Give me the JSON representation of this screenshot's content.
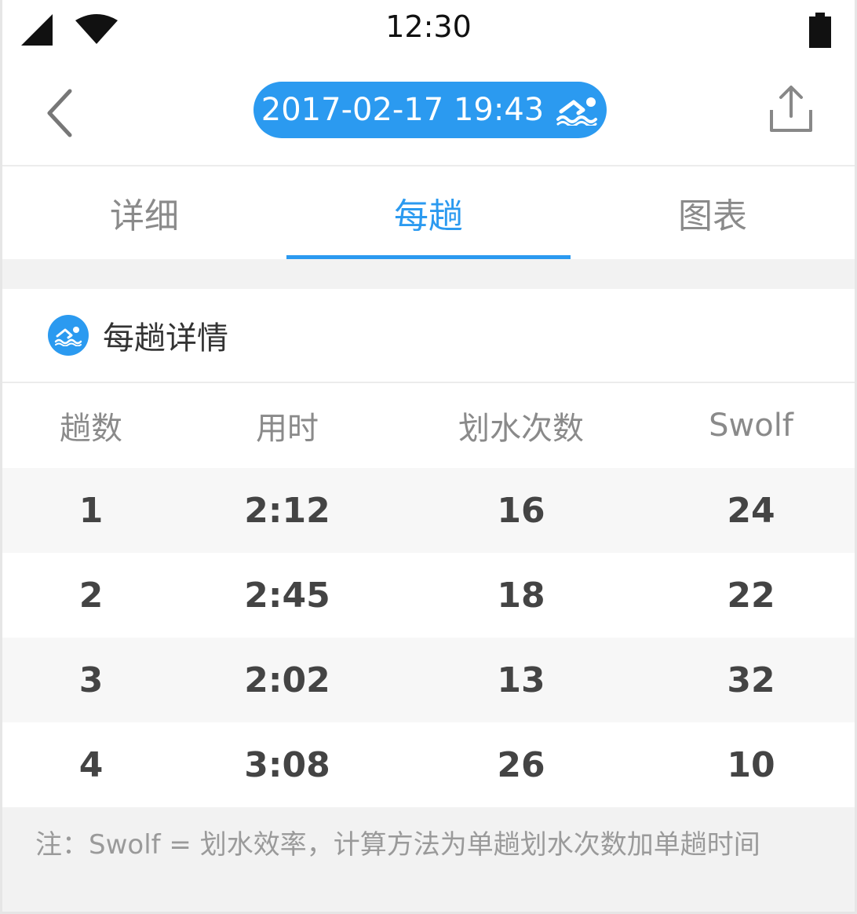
{
  "status_bar": {
    "time": "12:30",
    "icons": [
      "signal-icon",
      "wifi-icon",
      "battery-icon"
    ]
  },
  "header": {
    "date_label": "2017-02-17 19:43",
    "activity_icon": "swim-icon",
    "back_icon": "chevron-left-icon",
    "share_icon": "share-icon"
  },
  "tabs": [
    {
      "label": "详细",
      "active": false
    },
    {
      "label": "每趟",
      "active": true
    },
    {
      "label": "图表",
      "active": false
    }
  ],
  "section": {
    "title": "每趟详情",
    "icon": "swim-icon"
  },
  "table": {
    "headers": [
      "趟数",
      "用时",
      "划水次数",
      "Swolf"
    ],
    "rows": [
      [
        "1",
        "2:12",
        "16",
        "24"
      ],
      [
        "2",
        "2:45",
        "18",
        "22"
      ],
      [
        "3",
        "2:02",
        "13",
        "32"
      ],
      [
        "4",
        "3:08",
        "26",
        "10"
      ]
    ]
  },
  "note": "注：Swolf = 划水效率，计算方法为单趟划水次数加单趟时间",
  "colors": {
    "accent": "#2b9af0",
    "background": "#f2f2f2"
  }
}
